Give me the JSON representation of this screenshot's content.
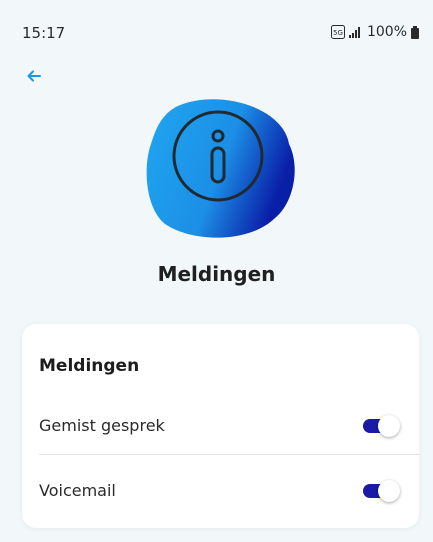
{
  "status_bar": {
    "time": "15:17",
    "network_badge": "5G",
    "battery": "100%"
  },
  "header": {
    "back_icon": "arrow-left-icon",
    "title": "Meldingen"
  },
  "hero": {
    "icon": "info-icon",
    "colors": {
      "blob_light": "#1fa6f0",
      "blob_dark": "#0a1fa8"
    }
  },
  "card": {
    "title": "Meldingen",
    "items": [
      {
        "label": "Gemist gesprek",
        "enabled": true
      },
      {
        "label": "Voicemail",
        "enabled": true
      }
    ]
  },
  "colors": {
    "background": "#f2f8fa",
    "accent": "#1a1aa6",
    "back_arrow": "#1a9be0"
  }
}
